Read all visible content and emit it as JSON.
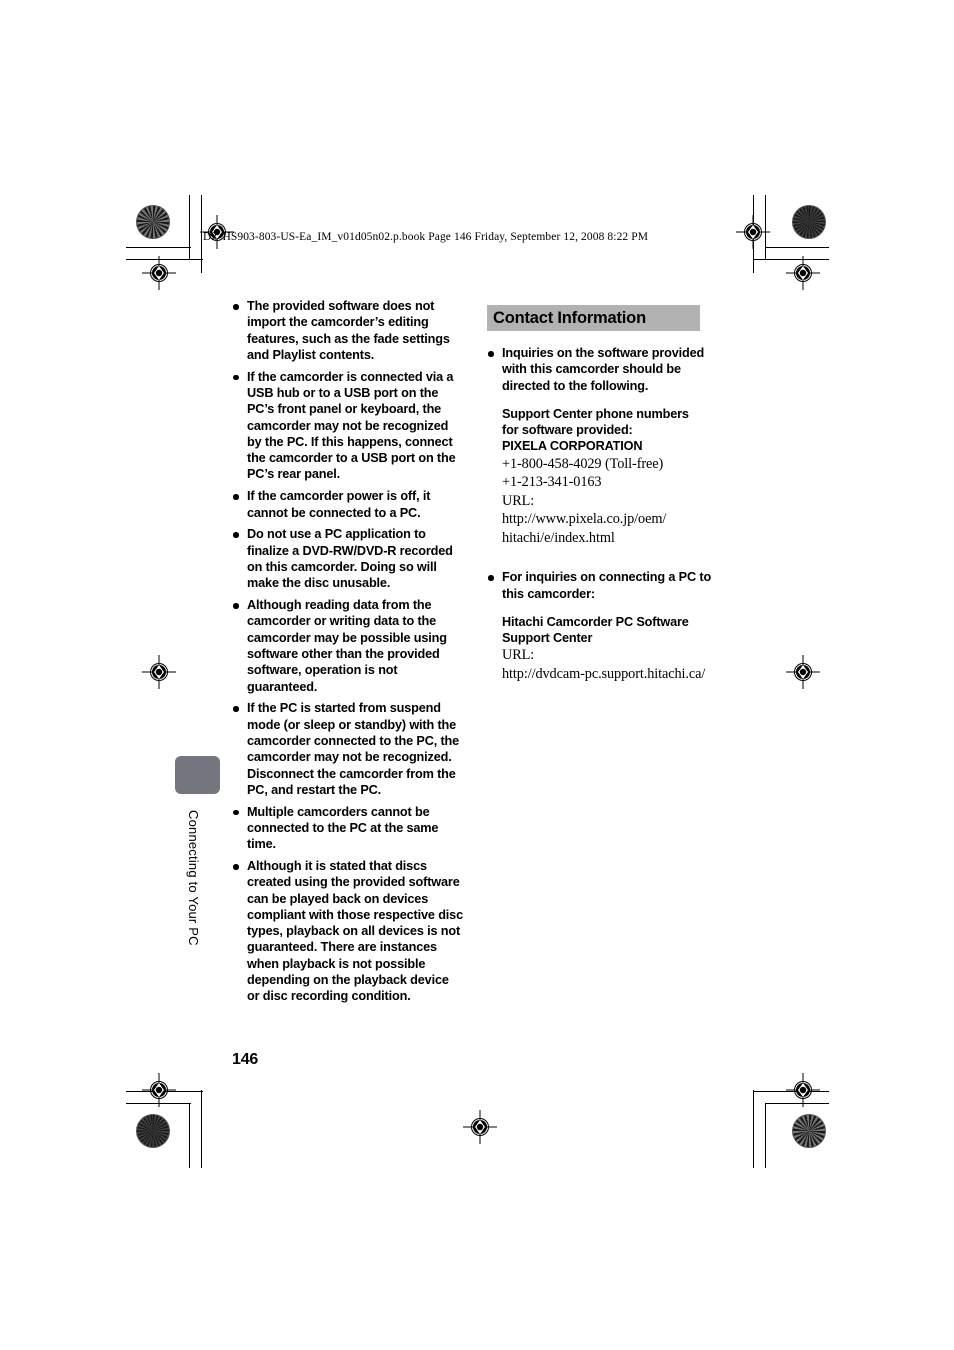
{
  "running_head": "DZ-HS903-803-US-Ea_IM_v01d05n02.p.book  Page 146  Friday, September 12, 2008  8:22 PM",
  "page_number": "146",
  "side_tab_label": "Connecting to Your PC",
  "colors": {
    "section_bar": "#b2b2b2",
    "side_tab": "#74767f",
    "text": "#000000",
    "page_background": "#ffffff"
  },
  "left_column": {
    "bullets": [
      "The provided software does not import the camcorder’s editing features, such as the fade settings and Playlist contents.",
      "If the camcorder is connected via a USB hub or to a USB port on the PC’s front panel or keyboard, the camcorder may not be recognized by the PC. If this happens, connect the camcorder to a USB port on the PC’s rear panel.",
      "If the camcorder power is off, it cannot be connected to a PC.",
      "Do not use a PC application to finalize a DVD-RW/DVD-R recorded on this camcorder. Doing so will make the disc unusable.",
      "Although reading data from the camcorder or writing data to the camcorder may be possible using software other than the provided software, operation is not guaranteed.",
      "If the PC is started from suspend mode (or sleep or standby) with the camcorder connected to the PC, the camcorder may not be recognized. Disconnect the camcorder from the PC, and restart the PC.",
      "Multiple camcorders cannot be connected to the PC at the same time.",
      "Although it is stated that discs created using the provided software can be played back on devices compliant with those respective disc types, playback on all devices is not guaranteed. There are instances when playback is not possible depending on the playback device or disc recording condition."
    ]
  },
  "right_column": {
    "section_title": "Contact Information",
    "bullet_1": "Inquiries on the software provided with this camcorder should be directed to the following.",
    "support_block_1": {
      "heading_line_1": "Support Center phone numbers",
      "heading_line_2": "for software provided:",
      "company": "PIXELA CORPORATION",
      "phone_1": "+1-800-458-4029 (Toll-free)",
      "phone_2": "+1-213-341-0163",
      "url_label": "URL:",
      "url_line_1": "http://www.pixela.co.jp/oem/",
      "url_line_2": "hitachi/e/index.html"
    },
    "bullet_2": "For inquiries on connecting a PC to this camcorder:",
    "support_block_2": {
      "heading_line_1": "Hitachi Camcorder PC Software",
      "heading_line_2": "Support Center",
      "url_label": "URL:",
      "url_line_1": "http://dvdcam-pc.support.hitachi.ca/"
    }
  }
}
